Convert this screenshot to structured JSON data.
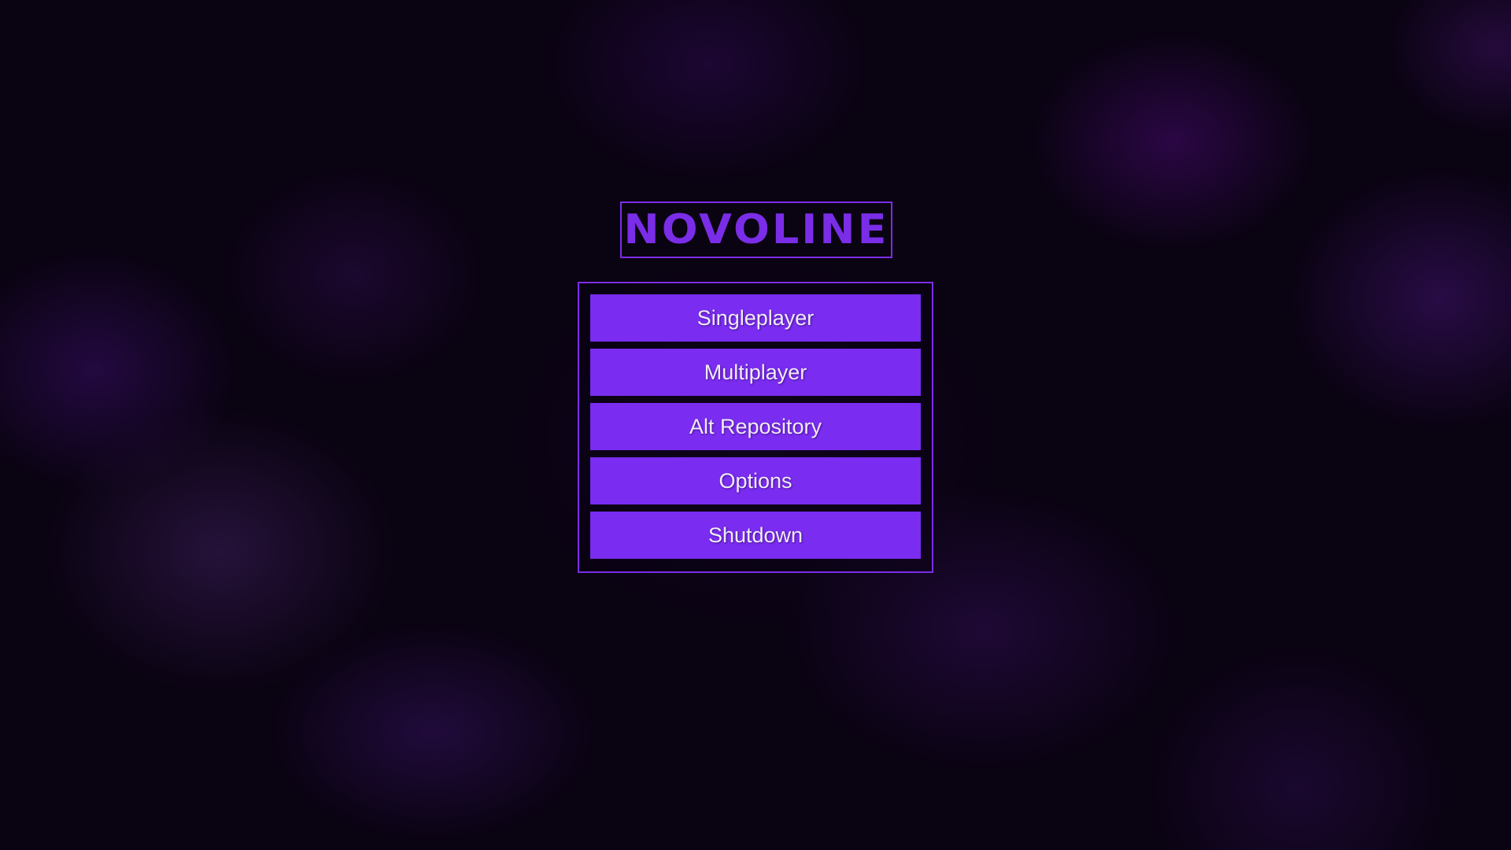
{
  "logo": {
    "text": "NOVOLINE"
  },
  "menu": {
    "buttons": [
      {
        "label": "Singleplayer"
      },
      {
        "label": "Multiplayer"
      },
      {
        "label": "Alt Repository"
      },
      {
        "label": "Options"
      },
      {
        "label": "Shutdown"
      }
    ]
  },
  "colors": {
    "accent": "#7a2cf0",
    "border": "#7c2de8",
    "background": "#0a0312",
    "button_text": "#f0ecf7"
  }
}
